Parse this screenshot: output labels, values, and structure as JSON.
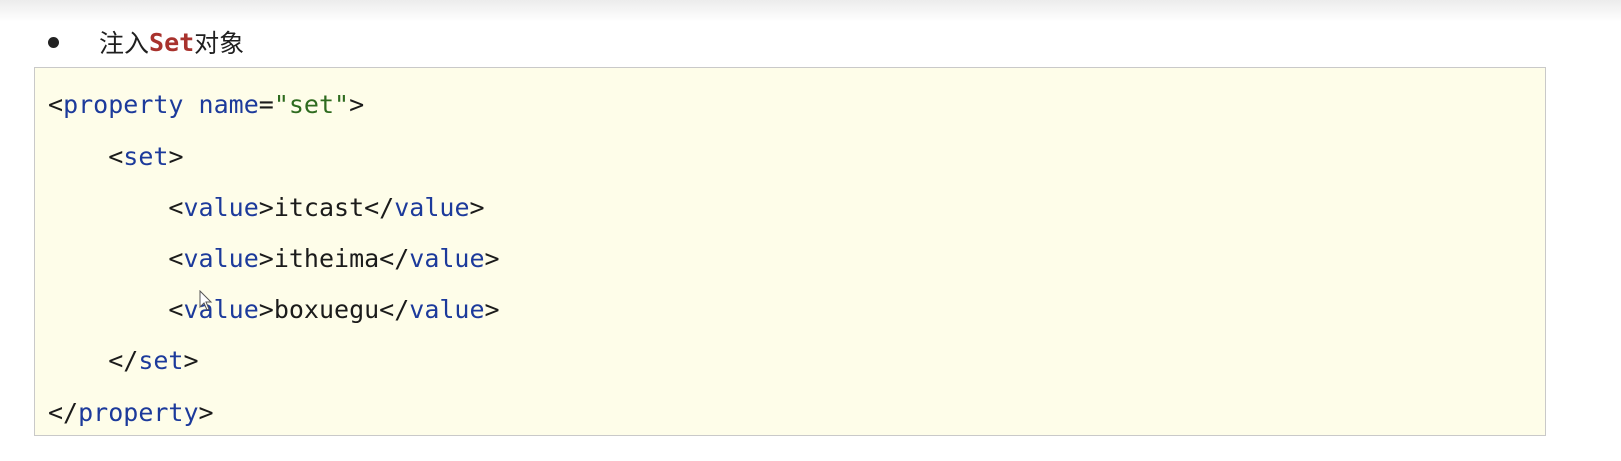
{
  "heading": {
    "prefix": "注入",
    "keyword": "Set",
    "suffix": "对象"
  },
  "code": {
    "line1": {
      "open": "<",
      "tag": "property",
      "space": " ",
      "attr": "name",
      "eq": "=",
      "value": "\"set\"",
      "close": ">"
    },
    "line2": {
      "indent": "    ",
      "open": "<",
      "tag": "set",
      "close": ">"
    },
    "values": [
      {
        "indent": "        ",
        "open": "<",
        "tag": "value",
        "mid": ">",
        "text": "itcast",
        "end_open": "</",
        "end_tag": "value",
        "close": ">"
      },
      {
        "indent": "        ",
        "open": "<",
        "tag": "value",
        "mid": ">",
        "text": "itheima",
        "end_open": "</",
        "end_tag": "value",
        "close": ">"
      },
      {
        "indent": "        ",
        "open": "<",
        "tag": "value",
        "mid": ">",
        "text": "boxuegu",
        "end_open": "</",
        "end_tag": "value",
        "close": ">"
      }
    ],
    "line6": {
      "indent": "    ",
      "open": "</",
      "tag": "set",
      "close": ">"
    },
    "line7": {
      "open": "</",
      "tag": "property",
      "close": ">"
    }
  }
}
